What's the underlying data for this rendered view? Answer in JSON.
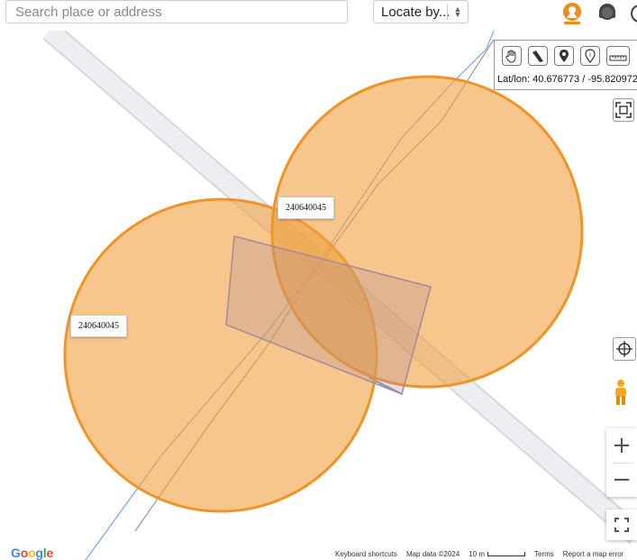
{
  "search": {
    "placeholder": "Search place or address",
    "value": ""
  },
  "locate": {
    "label": "Locate by..."
  },
  "top_icons": [
    "my-location-pin-icon",
    "support-headset-icon",
    "help-icon"
  ],
  "toolbar": {
    "tools": [
      "pan-hand-icon",
      "measure-tool-icon",
      "place-pin-icon",
      "info-pin-icon",
      "ruler-icon"
    ],
    "latlon_label": "Lat/lon:",
    "lat": "40.676773",
    "separator": "/",
    "lon": "-95.820972"
  },
  "map": {
    "features": [
      {
        "type": "circle",
        "label": "240640045",
        "color": "#f0a040"
      },
      {
        "type": "circle",
        "label": "240640045",
        "color": "#f0a040"
      },
      {
        "type": "parcel-polygon",
        "color": "#b090a0"
      }
    ],
    "road_color": "#e8eaed",
    "line_color": "#a0a0a0",
    "boundary_color": "#7aa7e8"
  },
  "controls": {
    "fit_bounds": "fit-bounds-icon",
    "recenter": "crosshair-icon",
    "street_view": "pegman-icon",
    "zoom_in": "+",
    "zoom_out": "−",
    "fullscreen": "fullscreen-icon"
  },
  "footer": {
    "google": "Google",
    "keyboard_shortcuts": "Keyboard shortcuts",
    "map_data": "Map data ©2024",
    "scale": "10 m",
    "terms": "Terms",
    "report": "Report a map error"
  }
}
